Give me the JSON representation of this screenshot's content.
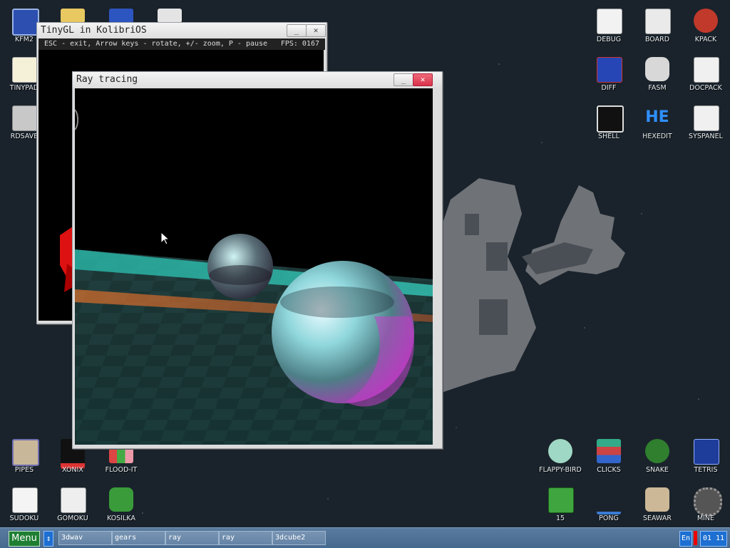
{
  "desktop": {
    "icons_left": [
      {
        "label": "KFM2",
        "icon": "floppy-disk-icon"
      },
      {
        "label": "TINYPAD",
        "icon": "notepad-icon"
      },
      {
        "label": "RDSAVE",
        "icon": "ram-disk-icon"
      }
    ],
    "icons_top_partial": [
      {
        "icon": "folder-icon"
      },
      {
        "icon": "monitor-app-icon"
      },
      {
        "icon": "calculator-icon"
      }
    ],
    "icons_right": [
      {
        "label": "DEBUG",
        "icon": "bug-icon"
      },
      {
        "label": "BOARD",
        "icon": "board-icon"
      },
      {
        "label": "KPACK",
        "icon": "wrench-icon"
      },
      {
        "label": "DIFF",
        "icon": "diff-icon"
      },
      {
        "label": "FASM",
        "icon": "fasm-anvil-icon"
      },
      {
        "label": "DOCPACK",
        "icon": "drawer-icon"
      },
      {
        "label": "SHELL",
        "icon": "terminal-icon"
      },
      {
        "label": "HEXEDIT",
        "icon": "hexedit-icon"
      },
      {
        "label": "SYSPANEL",
        "icon": "sliders-icon"
      }
    ],
    "icons_bottom_left": [
      {
        "label": "PIPES",
        "icon": "pipes-icon"
      },
      {
        "label": "XONIX",
        "icon": "xonix-icon"
      },
      {
        "label": "FLOOD-IT",
        "icon": "flood-it-icon"
      },
      {
        "label": "SUDOKU",
        "icon": "sudoku-icon"
      },
      {
        "label": "GOMOKU",
        "icon": "gomoku-icon"
      },
      {
        "label": "KOSILKA",
        "icon": "lawnmower-icon"
      }
    ],
    "icons_bottom_right": [
      {
        "label": "FLAPPY-BIRD",
        "icon": "bird-icon"
      },
      {
        "label": "CLICKS",
        "icon": "blocks-icon"
      },
      {
        "label": "SNAKE",
        "icon": "snake-icon"
      },
      {
        "label": "TETRIS",
        "icon": "tetris-icon"
      },
      {
        "label": "15",
        "icon": "fifteen-puzzle-icon"
      },
      {
        "label": "PONG",
        "icon": "pong-icon"
      },
      {
        "label": "SEAWAR",
        "icon": "ship-icon"
      },
      {
        "label": "MINE",
        "icon": "mine-icon"
      }
    ]
  },
  "windows": {
    "tinygl": {
      "title": "TinyGL in KolibriOS",
      "status": "ESC - exit, Arrow keys - rotate, +/- zoom, P - pause",
      "fps": "FPS: 0167",
      "minimize": "_",
      "close": "✕"
    },
    "raytracing": {
      "title": "Ray tracing",
      "minimize": "_",
      "close": "✕"
    }
  },
  "taskbar": {
    "menu": "Menu",
    "switch": "↕",
    "tasks": [
      "3dwav",
      "gears",
      "ray",
      "ray",
      "3dcube2"
    ],
    "lang": "En",
    "clock": "01 11"
  },
  "colors": {
    "accent_green": "#1e7e32",
    "accent_blue": "#1d6fd1",
    "taskbar": "#4f7397"
  }
}
